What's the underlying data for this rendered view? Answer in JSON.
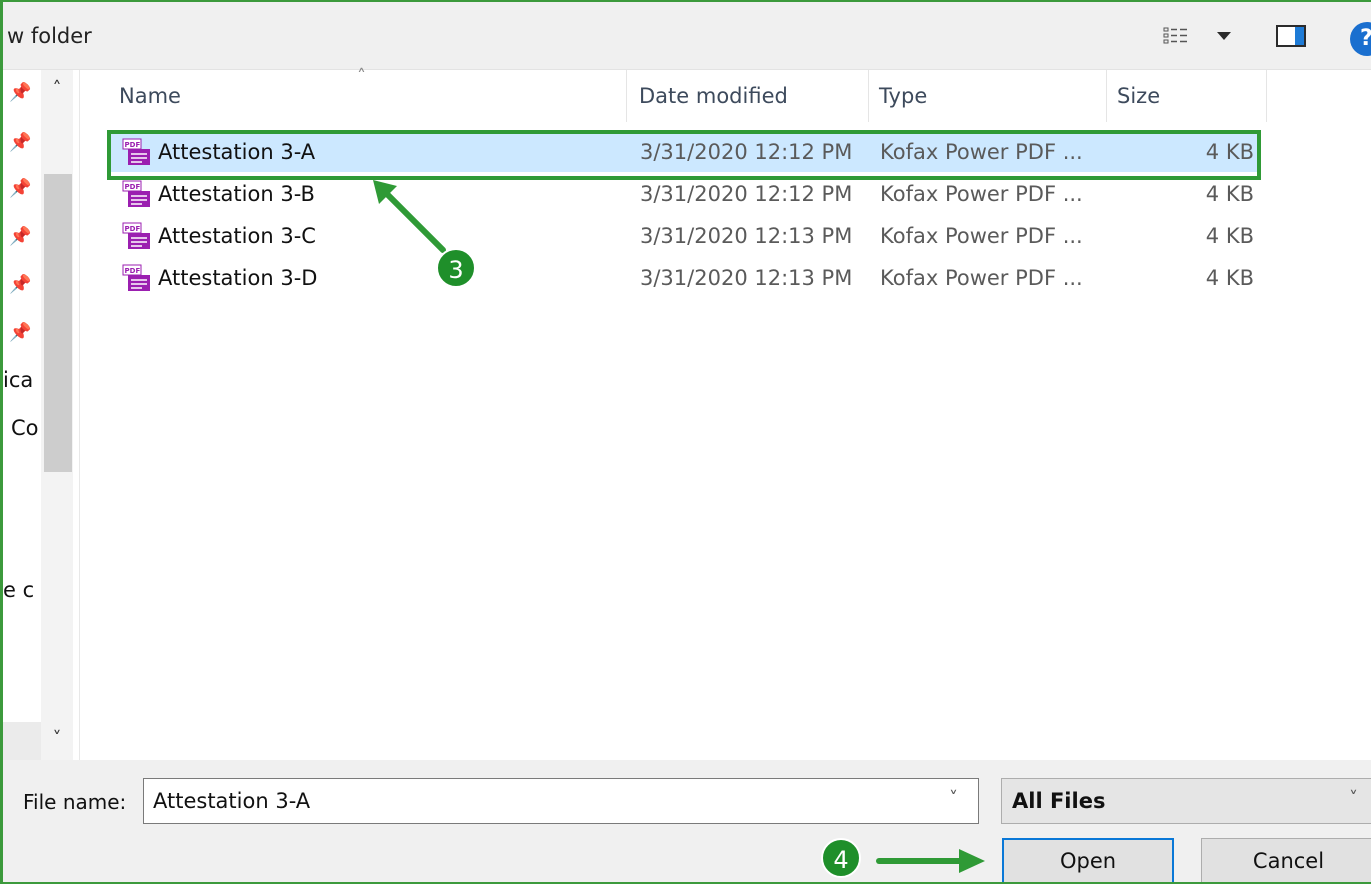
{
  "toolbar": {
    "new_folder_label": "w folder",
    "icons": [
      "views-icon",
      "chevron-down-icon",
      "preview-pane-icon",
      "help-icon"
    ],
    "help_glyph": "?"
  },
  "nav_pane": {
    "fragments": [
      "ica",
      "Co",
      "e c"
    ]
  },
  "columns": {
    "name": "Name",
    "date_modified": "Date modified",
    "type": "Type",
    "size": "Size"
  },
  "files": [
    {
      "name": "Attestation 3-A",
      "date": "3/31/2020 12:12 PM",
      "type": "Kofax Power PDF ...",
      "size": "4 KB",
      "selected": true
    },
    {
      "name": "Attestation 3-B",
      "date": "3/31/2020 12:12 PM",
      "type": "Kofax Power PDF ...",
      "size": "4 KB",
      "selected": false
    },
    {
      "name": "Attestation 3-C",
      "date": "3/31/2020 12:13 PM",
      "type": "Kofax Power PDF ...",
      "size": "4 KB",
      "selected": false
    },
    {
      "name": "Attestation 3-D",
      "date": "3/31/2020 12:13 PM",
      "type": "Kofax Power PDF ...",
      "size": "4 KB",
      "selected": false
    }
  ],
  "annotations": {
    "step_3": "3",
    "step_4": "4",
    "color": "#1f8f2a"
  },
  "bottom": {
    "file_name_label": "File name:",
    "file_name_value": "Attestation 3-A",
    "file_type_value": "All Files",
    "open_label": "Open",
    "cancel_label": "Cancel"
  },
  "colors": {
    "selection": "#cce8ff",
    "accent_blue": "#0a78d7",
    "annotation_green": "#2f9a36",
    "pdf_purple": "#9b1fb0"
  }
}
